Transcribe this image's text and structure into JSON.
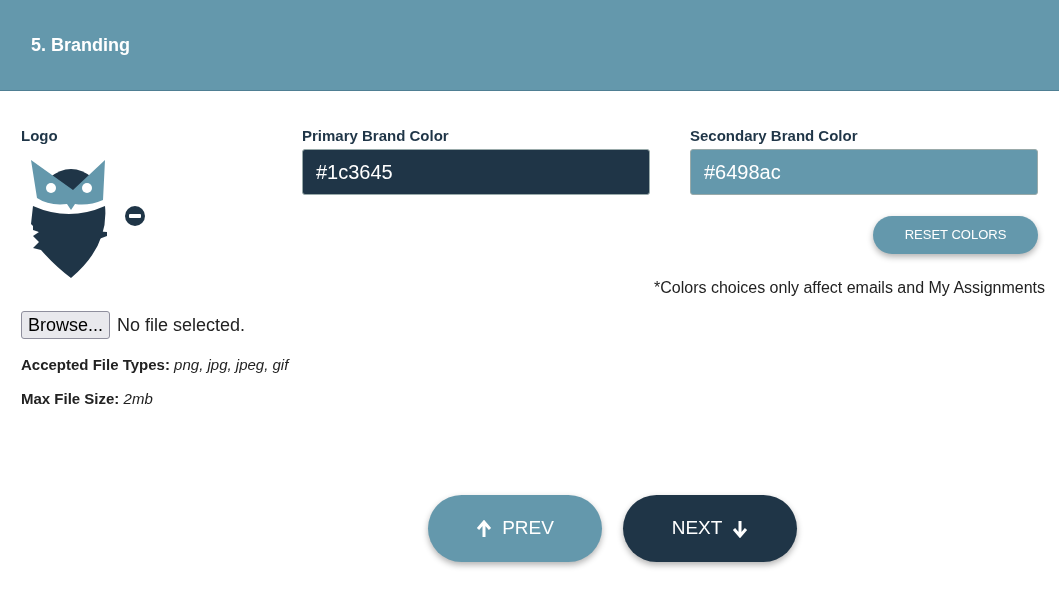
{
  "header": {
    "title": "5. Branding"
  },
  "logo": {
    "label": "Logo"
  },
  "file_input": {
    "button": "Browse...",
    "status": "No file selected."
  },
  "file_info": [
    {
      "label": "Accepted File Types:",
      "value": "png, jpg, jpeg, gif"
    },
    {
      "label": "Max File Size:",
      "value": "2mb"
    }
  ],
  "color_fields": [
    {
      "label": "Primary Brand Color",
      "value": "#1c3645",
      "color": "#1f3547"
    },
    {
      "label": "Secondary Brand Color",
      "value": "#6498ac",
      "color": "#6498ac"
    }
  ],
  "reset_button": "RESET COLORS",
  "note": "*Colors choices only affect emails and My Assignments",
  "nav_buttons": [
    {
      "kind": "prev",
      "label": "PREV"
    },
    {
      "kind": "next",
      "label": "NEXT"
    }
  ]
}
